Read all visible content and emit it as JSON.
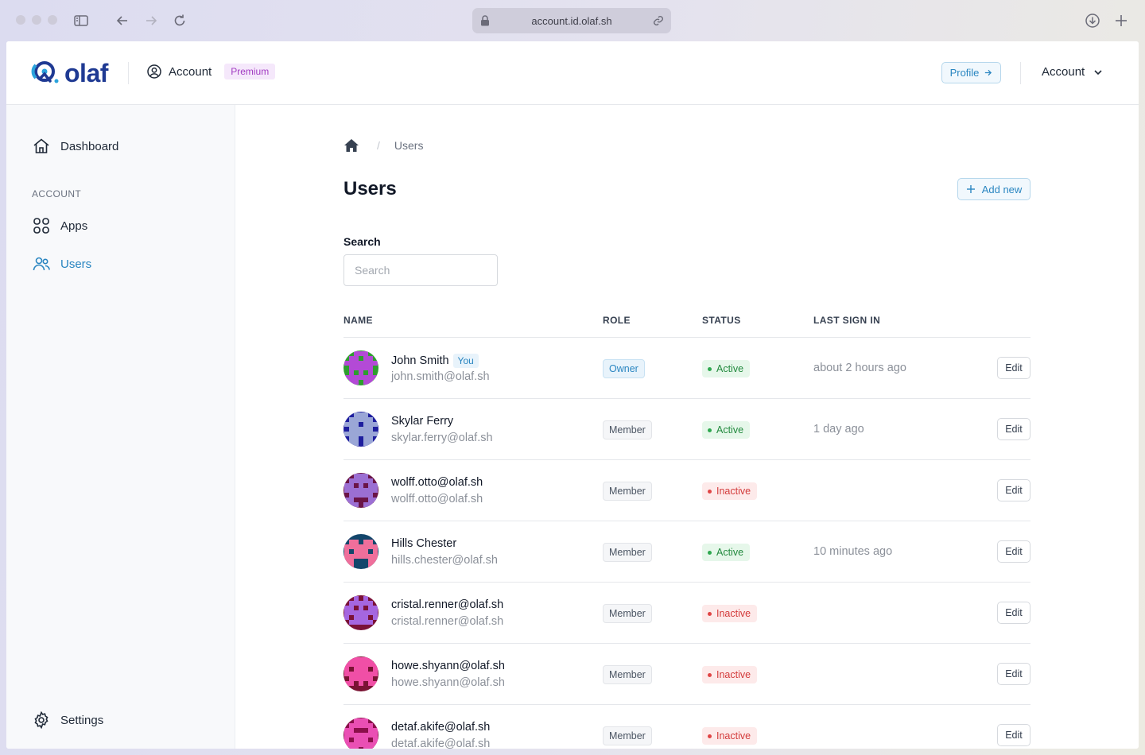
{
  "browser": {
    "url": "account.id.olaf.sh"
  },
  "brand": {
    "name": "olaf"
  },
  "header": {
    "account_label": "Account",
    "plan_badge": "Premium",
    "profile_button": "Profile",
    "account_menu": "Account"
  },
  "sidebar": {
    "dashboard": "Dashboard",
    "section_label": "ACCOUNT",
    "apps": "Apps",
    "users": "Users",
    "settings": "Settings"
  },
  "main": {
    "breadcrumb_current": "Users",
    "title": "Users",
    "add_button": "Add new",
    "search_label": "Search",
    "search_placeholder": "Search"
  },
  "table": {
    "columns": [
      "NAME",
      "ROLE",
      "STATUS",
      "LAST SIGN IN"
    ],
    "edit_label": "Edit",
    "you_badge": "You",
    "rows": [
      {
        "name": "John Smith",
        "email": "john.smith@olaf.sh",
        "role": "Owner",
        "status": "Active",
        "last_sign_in": "about 2 hours ago",
        "avatar": {
          "bg": "#2e9e2e",
          "fg": "#b34ad6"
        }
      },
      {
        "name": "Skylar Ferry",
        "email": "skylar.ferry@olaf.sh",
        "role": "Member",
        "status": "Active",
        "last_sign_in": "1 day ago",
        "avatar": {
          "bg": "#1e1e9e",
          "fg": "#9aa6d6"
        }
      },
      {
        "name": "wolff.otto@olaf.sh",
        "email": "wolff.otto@olaf.sh",
        "role": "Member",
        "status": "Inactive",
        "last_sign_in": "",
        "avatar": {
          "bg": "#6a1447",
          "fg": "#9b6fd3"
        }
      },
      {
        "name": "Hills Chester",
        "email": "hills.chester@olaf.sh",
        "role": "Member",
        "status": "Active",
        "last_sign_in": "10 minutes ago",
        "avatar": {
          "bg": "#13466b",
          "fg": "#ef6f9b"
        }
      },
      {
        "name": "cristal.renner@olaf.sh",
        "email": "cristal.renner@olaf.sh",
        "role": "Member",
        "status": "Inactive",
        "last_sign_in": "",
        "avatar": {
          "bg": "#7a1138",
          "fg": "#a566e0"
        }
      },
      {
        "name": "howe.shyann@olaf.sh",
        "email": "howe.shyann@olaf.sh",
        "role": "Member",
        "status": "Inactive",
        "last_sign_in": "",
        "avatar": {
          "bg": "#7a1333",
          "fg": "#f04fa6"
        }
      },
      {
        "name": "detaf.akife@olaf.sh",
        "email": "detaf.akife@olaf.sh",
        "role": "Member",
        "status": "Inactive",
        "last_sign_in": "",
        "avatar": {
          "bg": "#8a0f4a",
          "fg": "#ea4fb4"
        }
      }
    ]
  },
  "colors": {
    "accent": "#2a86c1",
    "brand": "#1f3a93",
    "premium": "#a23cc2"
  }
}
